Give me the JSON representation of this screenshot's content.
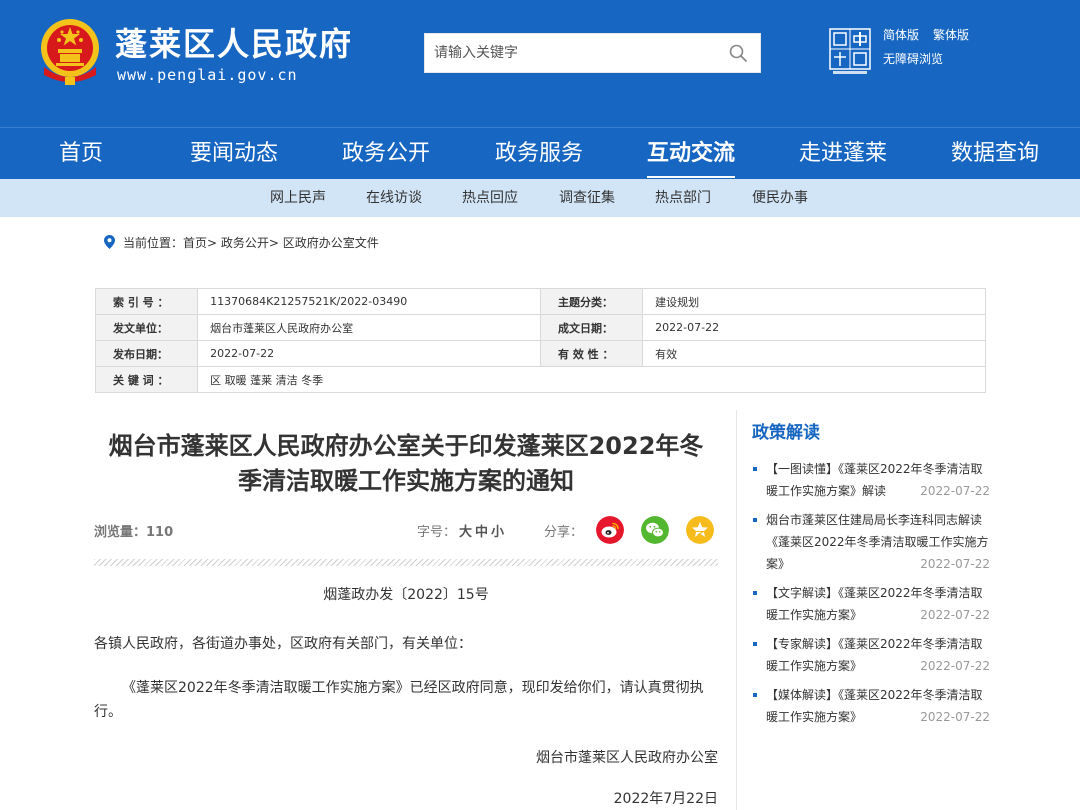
{
  "header": {
    "site_name": "蓬莱区人民政府",
    "site_url": "www.penglai.gov.cn",
    "search_placeholder": "请输入关键字",
    "lang_simplified": "简体版",
    "lang_traditional": "繁体版",
    "accessibility": "无障碍浏览",
    "colors": {
      "primary": "#1766c2",
      "subnav": "#d2e5f7",
      "emblem_red": "#d7191c",
      "emblem_gold": "#f3c31b"
    },
    "icons": [
      "national-emblem-icon",
      "search-icon",
      "yantai-china-logo-icon"
    ]
  },
  "main_nav": [
    {
      "label": "首页",
      "active": false
    },
    {
      "label": "要闻动态",
      "active": false
    },
    {
      "label": "政务公开",
      "active": false
    },
    {
      "label": "政务服务",
      "active": false
    },
    {
      "label": "互动交流",
      "active": true
    },
    {
      "label": "走进蓬莱",
      "active": false
    },
    {
      "label": "数据查询",
      "active": false
    }
  ],
  "sub_nav": [
    "网上民声",
    "在线访谈",
    "热点回应",
    "调查征集",
    "热点部门",
    "便民办事"
  ],
  "breadcrumb": {
    "prefix": "当前位置：",
    "items": [
      "首页",
      "政务公开",
      "区政府办公室文件"
    ],
    "separator": "> "
  },
  "meta": {
    "index_no_label": "索 引 号 ：",
    "index_no": "11370684K21257521K/2022-03490",
    "category_label": "主题分类：",
    "category": "建设规划",
    "issuer_label": "发文单位：",
    "issuer": "烟台市蓬莱区人民政府办公室",
    "created_label": "成文日期：",
    "created": "2022-07-22",
    "published_label": "发布日期：",
    "published": "2022-07-22",
    "validity_label": "有 效 性 ：",
    "validity": "有效",
    "keywords_label": "关 键 词 ：",
    "keywords": "区 取暖 蓬莱 清洁 冬季"
  },
  "article": {
    "title_line1": "烟台市蓬莱区人民政府办公室关于印发蓬莱区2022年冬",
    "title_line2": "季清洁取暖工作实施方案的通知",
    "views": "浏览量：110",
    "font_size_label": "字号：",
    "font_large": "大",
    "font_medium": "中",
    "font_small": "小",
    "share_label": "分享：",
    "share_icons": [
      "weibo-icon",
      "wechat-icon",
      "qzone-icon"
    ],
    "doc_no": "烟蓬政办发〔2022〕15号",
    "salutation": "各镇人民政府，各街道办事处，区政府有关部门，有关单位：",
    "paragraph": "《蓬莱区2022年冬季清洁取暖工作实施方案》已经区政府同意，现印发给你们，请认真贯彻执行。",
    "signer": "烟台市蓬莱区人民政府办公室",
    "date": "2022年7月22日"
  },
  "sidebar": {
    "title": "政策解读",
    "items": [
      {
        "text": "【一图读懂】《蓬莱区2022年冬季清洁取暖工作实施方案》解读",
        "date": "2022-07-22"
      },
      {
        "text": "烟台市蓬莱区住建局局长李连科同志解读《蓬莱区2022年冬季清洁取暖工作实施方案》",
        "date": "2022-07-22"
      },
      {
        "text": "【文字解读】《蓬莱区2022年冬季清洁取暖工作实施方案》",
        "date": "2022-07-22"
      },
      {
        "text": "【专家解读】《蓬莱区2022年冬季清洁取暖工作实施方案》",
        "date": "2022-07-22"
      },
      {
        "text": "【媒体解读】《蓬莱区2022年冬季清洁取暖工作实施方案》",
        "date": "2022-07-22"
      }
    ]
  }
}
